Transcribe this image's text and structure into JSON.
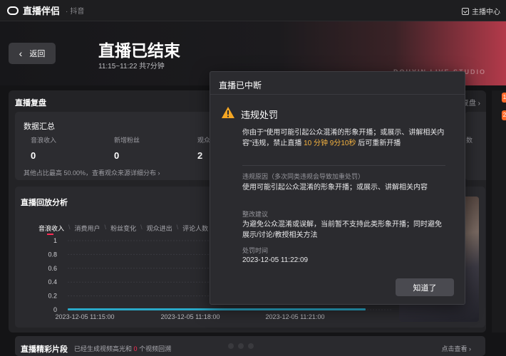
{
  "topbar": {
    "app_name": "直播伴侣",
    "platform": "抖音",
    "studio_center": "主播中心"
  },
  "header": {
    "back_label": "返回",
    "title": "直播已结束",
    "time_range": "11:15~11:22 共7分钟",
    "watermark": "DOUYIN LIVE STUDIO"
  },
  "review": {
    "title": "直播复盘",
    "more": "复盘",
    "summary": {
      "title": "数据汇总",
      "metrics": [
        {
          "label": "音浪收入",
          "value": "0"
        },
        {
          "label": "新增粉丝",
          "value": "0"
        },
        {
          "label": "观众",
          "value": "2"
        }
      ],
      "note": "其他占比最高 50.00%，查看观众来源详细分布 ›",
      "right_label": "数"
    },
    "analysis": {
      "title": "直播回放分析",
      "tabs": [
        "音浪收入",
        "消费用户",
        "粉丝变化",
        "观众进出",
        "评论人数"
      ],
      "active_tab": 0
    },
    "clips": {
      "title": "直播精彩片段",
      "desc_prefix": "已经生成视频高光和",
      "count": "0",
      "desc_suffix": "个视频回溯",
      "cta": "点击查看"
    }
  },
  "chart_data": {
    "type": "line",
    "x": [
      "2023-12-05 11:15:00",
      "2023-12-05 11:18:00",
      "2023-12-05 11:21:00"
    ],
    "y_ticks": [
      "0",
      "0.2",
      "0.4",
      "0.6",
      "0.8",
      "1"
    ],
    "ylim": [
      0,
      1
    ],
    "series": [
      {
        "values": [
          0,
          0,
          0
        ]
      }
    ],
    "accent": "#fe2c55",
    "timeline_color": "#2aa9c8"
  },
  "modal": {
    "title": "直播已中断",
    "subtitle": "违规处罚",
    "message_prefix": "你由于“使用可能引起公众混淆的形象开播；或展示、讲解相关内容”违规，禁止直播 ",
    "ban_duration": "10 分钟 9分10秒",
    "message_suffix": " 后可重新开播",
    "reason_label": "违规原因（多次同类违规会导致加重处罚）",
    "reason": "使用可能引起公众混淆的形象开播；或展示、讲解相关内容",
    "advice_label": "整改建议",
    "advice": "为避免公众混淆或误解，当前暂不支持此类形象开播；同时避免展示/讨论/教授相关方法",
    "time_label": "处罚时间",
    "time": "2023-12-05 11:22:09",
    "ok_label": "知道了",
    "warning_color": "#f5a623"
  },
  "side_badges": [
    "1",
    "2"
  ]
}
